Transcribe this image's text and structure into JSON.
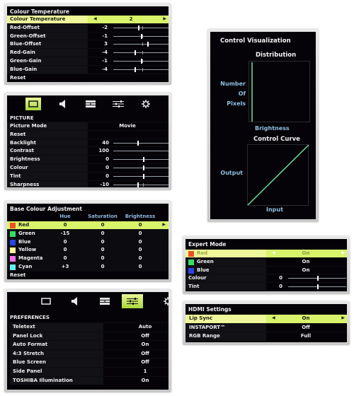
{
  "colour_temperature": {
    "title": "Colour Temperature",
    "selected": {
      "label": "Colour Temperature",
      "value": "2"
    },
    "rows": [
      {
        "label": "Red-Offset",
        "value": "-2",
        "level": 0.43
      },
      {
        "label": "Green-Offset",
        "value": "-1",
        "level": 0.47
      },
      {
        "label": "Blue-Offset",
        "value": "3",
        "level": 0.59
      },
      {
        "label": "Red-Gain",
        "value": "-4",
        "level": 0.37
      },
      {
        "label": "Green-Gain",
        "value": "-1",
        "level": 0.47
      },
      {
        "label": "Blue-Gain",
        "value": "-4",
        "level": 0.37
      }
    ],
    "reset": "Reset"
  },
  "picture": {
    "icons": [
      "picture-icon",
      "sound-icon",
      "setup-icon",
      "preferences-icon",
      "settings-gear-icon"
    ],
    "active_icon": 0,
    "section": "PICTURE",
    "mode": {
      "label": "Picture Mode",
      "value": "Movie"
    },
    "reset": "Reset",
    "rows": [
      {
        "label": "Backlight",
        "value": "40",
        "level": 0.4
      },
      {
        "label": "Contrast",
        "value": "100",
        "level": 1.0
      },
      {
        "label": "Brightness",
        "value": "0",
        "level": 0.5
      },
      {
        "label": "Colour",
        "value": "0",
        "level": 0.5
      },
      {
        "label": "Tint",
        "value": "0",
        "level": 0.5
      },
      {
        "label": "Sharpness",
        "value": "-10",
        "level": 0.4
      }
    ]
  },
  "base_colour": {
    "title": "Base Colour Adjustment",
    "headers": [
      "Hue",
      "Saturation",
      "Brightness"
    ],
    "rows": [
      {
        "label": "Red",
        "color": "#f05020",
        "hue": "0",
        "saturation": "0",
        "brightness": "0",
        "selected": true
      },
      {
        "label": "Green",
        "color": "#33e066",
        "hue": "-15",
        "saturation": "0",
        "brightness": "0"
      },
      {
        "label": "Blue",
        "color": "#2a44e8",
        "hue": "0",
        "saturation": "0",
        "brightness": "0"
      },
      {
        "label": "Yellow",
        "color": "#fff59a",
        "hue": "0",
        "saturation": "0",
        "brightness": "0"
      },
      {
        "label": "Magenta",
        "color": "#f070e8",
        "hue": "0",
        "saturation": "0",
        "brightness": "0"
      },
      {
        "label": "Cyan",
        "color": "#60f0f0",
        "hue": "+3",
        "saturation": "0",
        "brightness": "0"
      }
    ],
    "reset": "Reset"
  },
  "preferences": {
    "icons": [
      "picture-icon",
      "sound-icon",
      "setup-icon",
      "preferences-icon",
      "settings-gear-icon"
    ],
    "active_icon": 3,
    "section": "PREFERENCES",
    "rows": [
      {
        "label": "Teletext",
        "value": "Auto"
      },
      {
        "label": "Panel Lock",
        "value": "Off"
      },
      {
        "label": "Auto Format",
        "value": "On"
      },
      {
        "label": "4:3 Stretch",
        "value": "Off"
      },
      {
        "label": "Blue Screen",
        "value": "Off"
      },
      {
        "label": "Side Panel",
        "value": "1"
      },
      {
        "label": "TOSHIBA Illumination",
        "value": "On"
      }
    ]
  },
  "control_visualization": {
    "title": "Control Visualization",
    "distribution_title": "Distribution",
    "y_label_lines": [
      "Number",
      "Of",
      "Pixels"
    ],
    "x_label": "Brightness",
    "curve_title": "Control Curve",
    "curve_y_label": "Output",
    "curve_x_label": "Input",
    "line_color": "#6ee0a0"
  },
  "expert_mode": {
    "title": "Expert Mode",
    "rows": [
      {
        "label": "Red",
        "color": "#f05020",
        "value": "On",
        "selected": true
      },
      {
        "label": "Green",
        "color": "#33e066",
        "value": "On"
      },
      {
        "label": "Blue",
        "color": "#2a44e8",
        "value": "On"
      }
    ],
    "sliders": [
      {
        "label": "Colour",
        "value": "0",
        "level": 0.5
      },
      {
        "label": "Tint",
        "value": "0",
        "level": 0.5
      }
    ]
  },
  "hdmi": {
    "title": "HDMI Settings",
    "rows": [
      {
        "label": "Lip Sync",
        "value": "On",
        "selected": true
      },
      {
        "label": "INSTAPORT™",
        "value": "Off"
      },
      {
        "label": "RGB Range",
        "value": "Full"
      }
    ]
  },
  "accent_color": "#d9f36a"
}
